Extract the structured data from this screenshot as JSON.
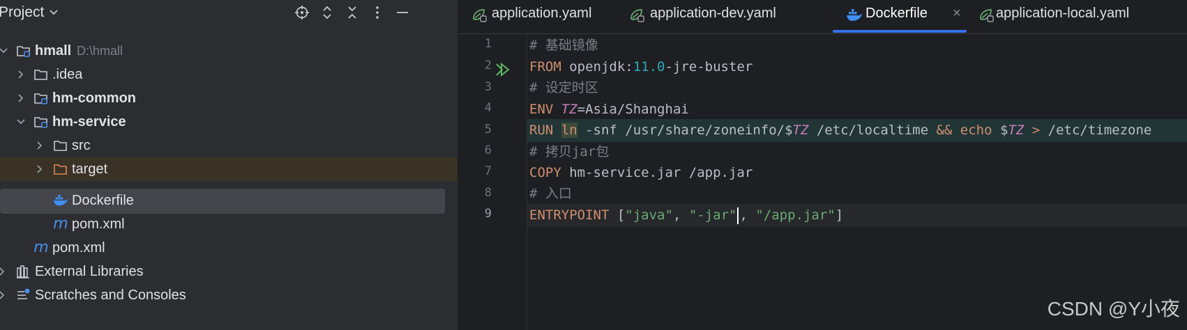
{
  "project": {
    "title": "Project",
    "tree": [
      {
        "id": "hmall",
        "label": "hmall",
        "path": "D:\\hmall"
      },
      {
        "id": "idea",
        "label": ".idea"
      },
      {
        "id": "hm-common",
        "label": "hm-common"
      },
      {
        "id": "hm-service",
        "label": "hm-service"
      },
      {
        "id": "src",
        "label": "src"
      },
      {
        "id": "target",
        "label": "target"
      },
      {
        "id": "dockerfile",
        "label": "Dockerfile"
      },
      {
        "id": "pom-service",
        "label": "pom.xml",
        "icon_text": "m"
      },
      {
        "id": "pom-root",
        "label": "pom.xml",
        "icon_text": "m"
      },
      {
        "id": "external-libraries",
        "label": "External Libraries"
      },
      {
        "id": "scratches",
        "label": "Scratches and Consoles"
      }
    ]
  },
  "tabs": [
    {
      "label": "application.yaml"
    },
    {
      "label": "application-dev.yaml"
    },
    {
      "label": "Dockerfile",
      "close": "×"
    },
    {
      "label": "application-local.yaml"
    }
  ],
  "editor": {
    "line_numbers": [
      "1",
      "2",
      "3",
      "4",
      "5",
      "6",
      "7",
      "8",
      "9"
    ],
    "line1": {
      "comment": "# 基础镜像"
    },
    "line2": {
      "kw": "FROM",
      "a": " openjdk:",
      "num": "11.0",
      "b": "-jre-buster"
    },
    "line3": {
      "comment": "# 设定时区"
    },
    "line4": {
      "kw": "ENV",
      "var": "TZ",
      "a": "=Asia/Shanghai"
    },
    "line5": {
      "kw": "RUN",
      "ln": "ln",
      "a": " -snf /usr/share/zoneinfo/$",
      "var1": "TZ",
      "b": " /etc/localtime ",
      "and": "&&",
      "echo": " echo",
      "c": " $",
      "var2": "TZ",
      "gt": " >",
      "d": " /etc/timezone"
    },
    "line6": {
      "comment": "# 拷贝jar包"
    },
    "line7": {
      "kw": "COPY",
      "a": " hm-service.jar /app.jar"
    },
    "line8": {
      "comment": "# 入口"
    },
    "line9": {
      "kw": "ENTRYPOINT",
      "a": " [",
      "s1": "\"java\"",
      "c1": ", ",
      "s2": "\"-jar\"",
      "c2": ", ",
      "s3": "\"/app.jar\"",
      "b": "]"
    }
  },
  "watermark": "CSDN @Y小夜",
  "colors": {
    "accent": "#3574f0",
    "keyword": "#cf8e6d",
    "string": "#6aab73",
    "number": "#2aacb8",
    "variable": "#c77dbb",
    "comment": "#7a7e85"
  }
}
